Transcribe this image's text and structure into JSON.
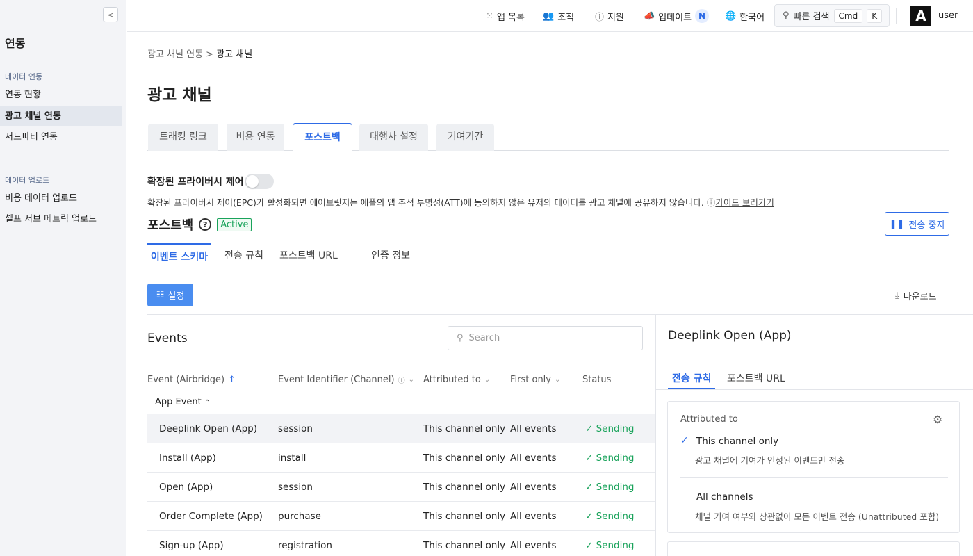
{
  "sidebar": {
    "title": "연동",
    "sections": [
      {
        "label": "데이터 연동",
        "items": [
          "연동 현황",
          "광고 채널 연동",
          "서드파티 연동"
        ]
      },
      {
        "label": "데이터 업로드",
        "items": [
          "비용 데이터 업로드",
          "셀프 서브 메트릭 업로드"
        ]
      }
    ],
    "active_item": "광고 채널 연동"
  },
  "topbar": {
    "app_list": "앱 목록",
    "org": "조직",
    "support": "지원",
    "update": "업데이트",
    "update_badge": "N",
    "language": "한국어",
    "quick_search": "빠른 검색",
    "kbd_cmd": "Cmd",
    "kbd_k": "K",
    "avatar_letter": "A",
    "user": "user"
  },
  "breadcrumb": {
    "parent": "광고 채널 연동",
    "sep": ">",
    "current": "광고 채널"
  },
  "page_title": "광고 채널",
  "tabs": [
    "트래킹 링크",
    "비용 연동",
    "포스트백",
    "대행사 설정",
    "기여기간"
  ],
  "active_tab": "포스트백",
  "privacy": {
    "label": "확장된 프라이버시 제어",
    "enabled": false,
    "description": "확장된 프라이버시 제어(EPC)가 활성화되면 에어브릿지는 애플의 앱 추적 투명성(ATT)에 동의하지 않은 유저의 데이터를 광고 채널에 공유하지 않습니다.",
    "guide_link": "가이드 보러가기"
  },
  "postback": {
    "title": "포스트백",
    "status": "Active",
    "stop_button": "전송 중지",
    "subtabs": [
      "이벤트 스키마",
      "전송 규칙",
      "포스트백 URL",
      "인증 정보"
    ],
    "settings_button": "설정",
    "download": "다운로드"
  },
  "events": {
    "title": "Events",
    "search_placeholder": "Search",
    "columns": [
      "Event (Airbridge)",
      "Event Identifier (Channel)",
      "Attributed to",
      "First only",
      "Status"
    ],
    "group": "App Event",
    "rows": [
      [
        "Deeplink Open (App)",
        "session",
        "This channel only",
        "All events",
        "Sending"
      ],
      [
        "Install (App)",
        "install",
        "This channel only",
        "All events",
        "Sending"
      ],
      [
        "Open (App)",
        "session",
        "This channel only",
        "All events",
        "Sending"
      ],
      [
        "Order Complete (App)",
        "purchase",
        "This channel only",
        "All events",
        "Sending"
      ],
      [
        "Sign-up (App)",
        "registration",
        "This channel only",
        "All events",
        "Sending"
      ]
    ]
  },
  "detail": {
    "title": "Deeplink Open (App)",
    "tabs": [
      "전송 규칙",
      "포스트백 URL"
    ],
    "attributed_label": "Attributed to",
    "options": [
      {
        "title": "This channel only",
        "desc": "광고 채널에 기여가 인정된 이벤트만 전송"
      },
      {
        "title": "All channels",
        "desc": "채널 기여 여부와 상관없이 모든 이벤트 전송 (Unattributed 포함)"
      }
    ]
  }
}
